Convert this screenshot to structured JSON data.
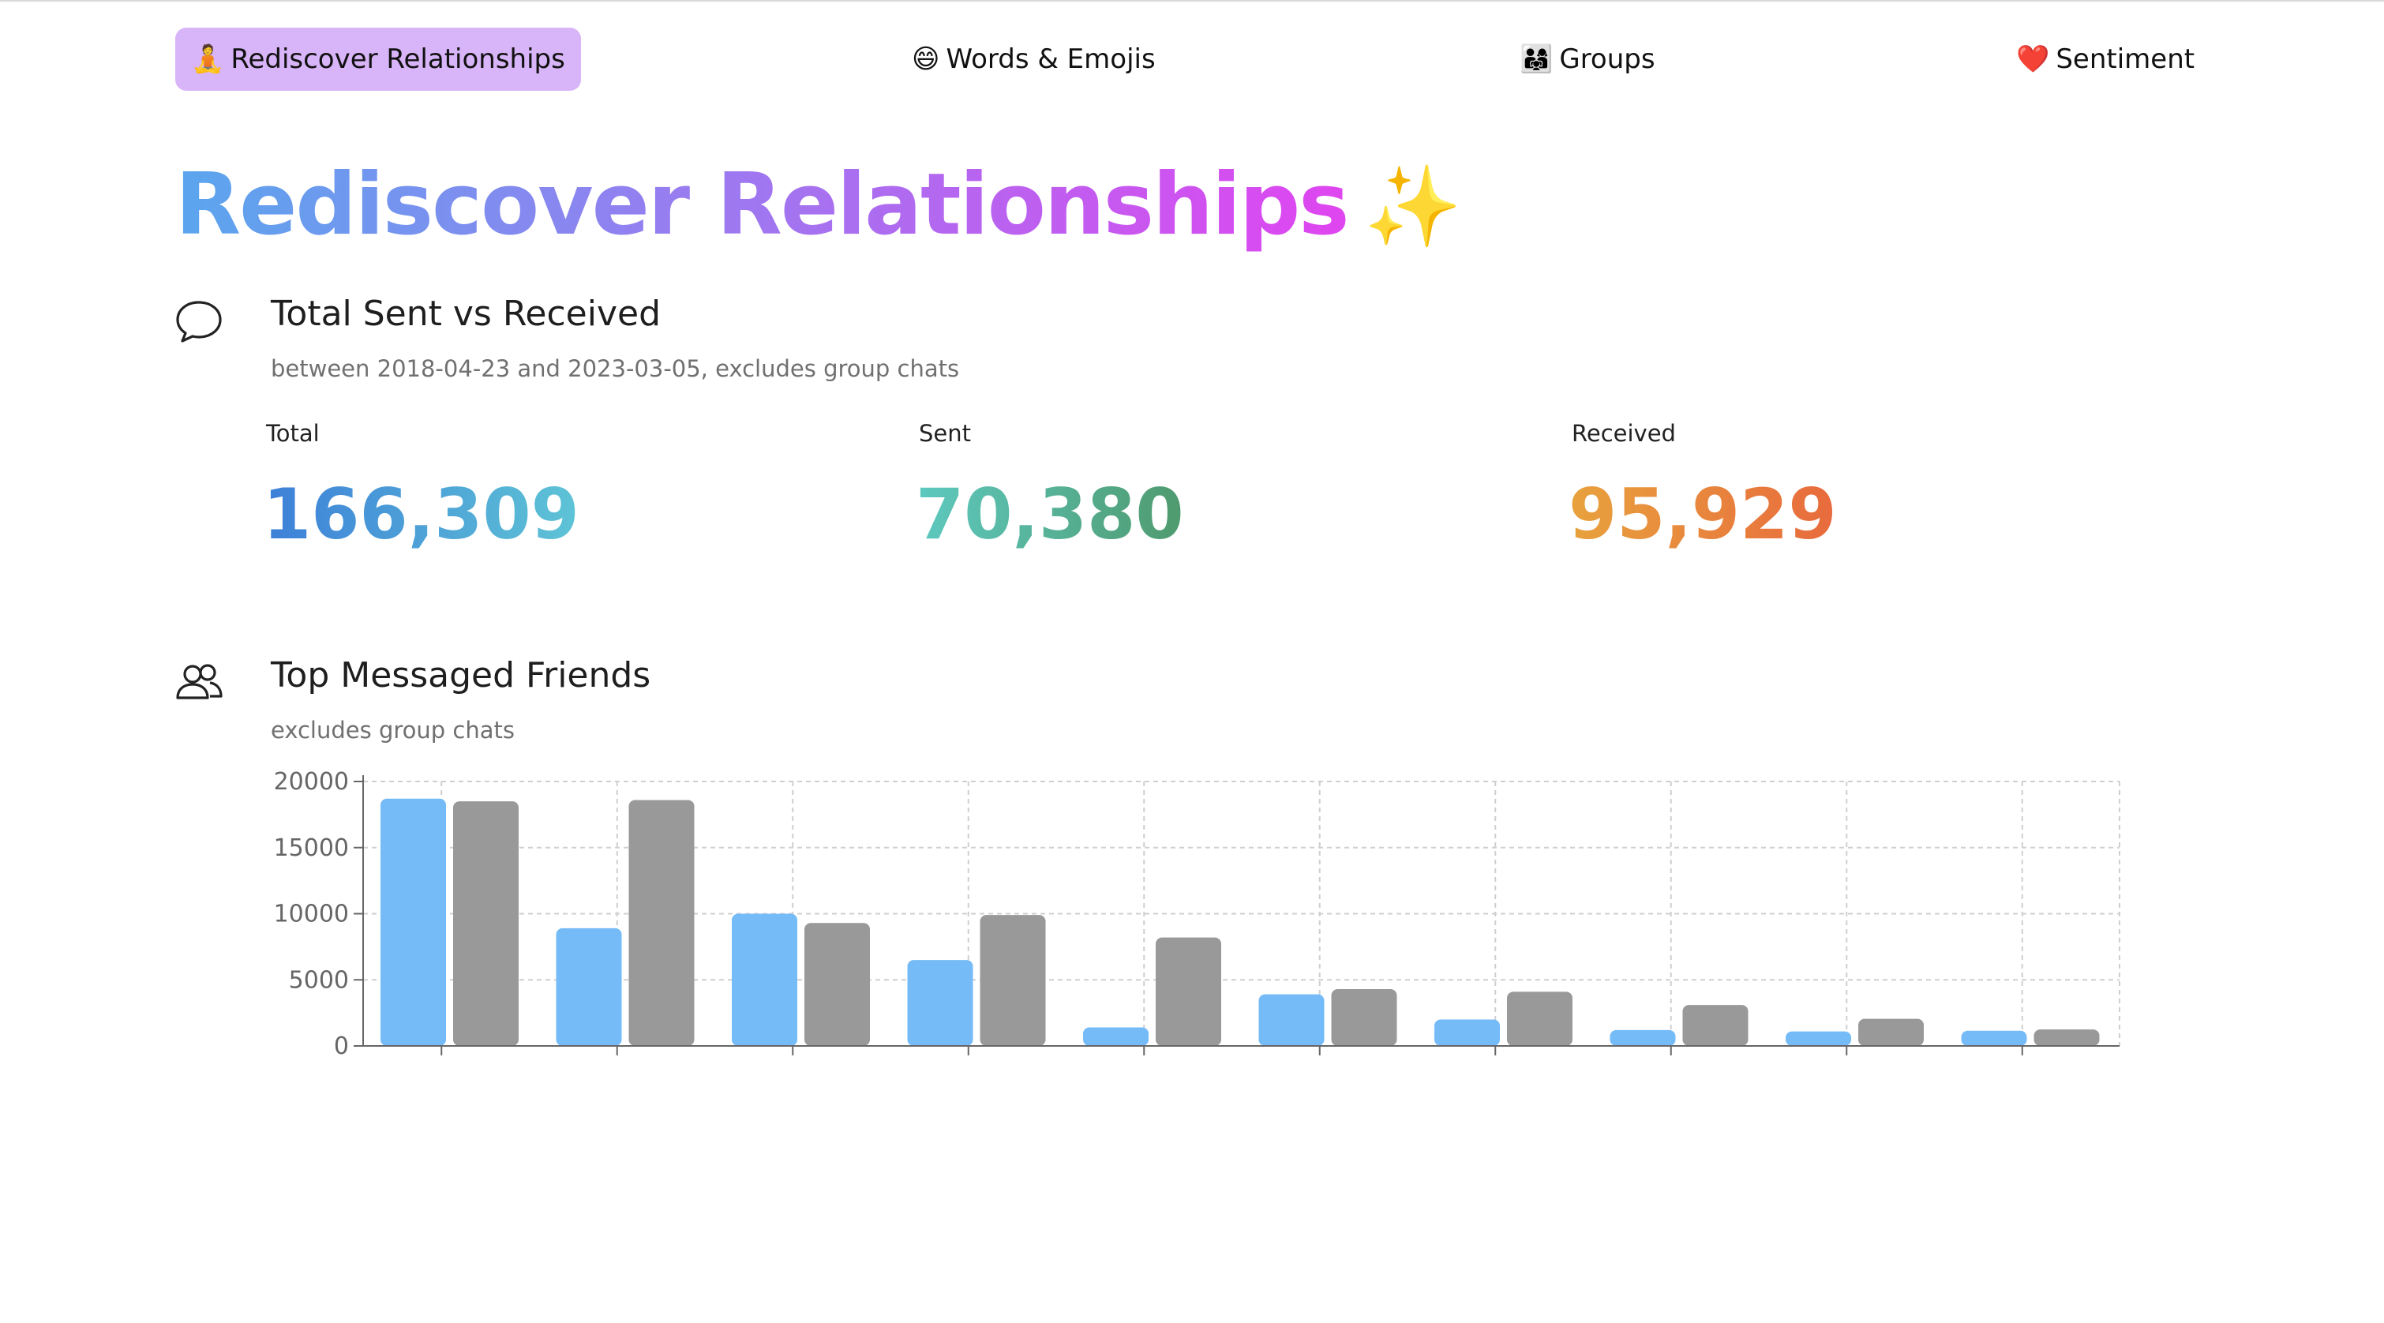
{
  "nav": {
    "items": [
      {
        "emoji": "🧘",
        "label": "Rediscover Relationships",
        "active": true
      },
      {
        "emoji": "😄",
        "label": "Words & Emojis",
        "active": false
      },
      {
        "emoji": "👨‍👩‍👧",
        "label": "Groups",
        "active": false
      },
      {
        "emoji": "❤️",
        "label": "Sentiment",
        "active": false
      }
    ]
  },
  "page": {
    "title": "Rediscover Relationships",
    "title_emoji": "✨"
  },
  "sent_received": {
    "icon": "speech-bubble-icon",
    "title": "Total Sent vs Received",
    "subtitle": "between 2018-04-23 and 2023-03-05, excludes group chats",
    "stats": {
      "total": {
        "label": "Total",
        "value": "166,309"
      },
      "sent": {
        "label": "Sent",
        "value": "70,380"
      },
      "received": {
        "label": "Received",
        "value": "95,929"
      }
    }
  },
  "top_friends": {
    "icon": "users-icon",
    "title": "Top Messaged Friends",
    "subtitle": "excludes group chats"
  },
  "colors": {
    "sent": "#74bbf7",
    "received": "#999999",
    "active_tab": "#d8b4f8"
  },
  "chart_data": {
    "type": "bar",
    "categories": [
      "",
      "",
      "",
      "",
      "",
      "",
      "",
      "",
      "",
      ""
    ],
    "series": [
      {
        "values": [
          18700,
          8900,
          10000,
          6500,
          1400,
          3900,
          2000,
          1200,
          1100,
          1150
        ]
      },
      {
        "values": [
          18500,
          18600,
          9300,
          9900,
          8200,
          4300,
          4100,
          3100,
          2050,
          1250
        ]
      }
    ],
    "ylim": [
      0,
      20000
    ],
    "yticks": [
      "0",
      "5000",
      "10000",
      "15000",
      "20000"
    ],
    "grid": true
  }
}
